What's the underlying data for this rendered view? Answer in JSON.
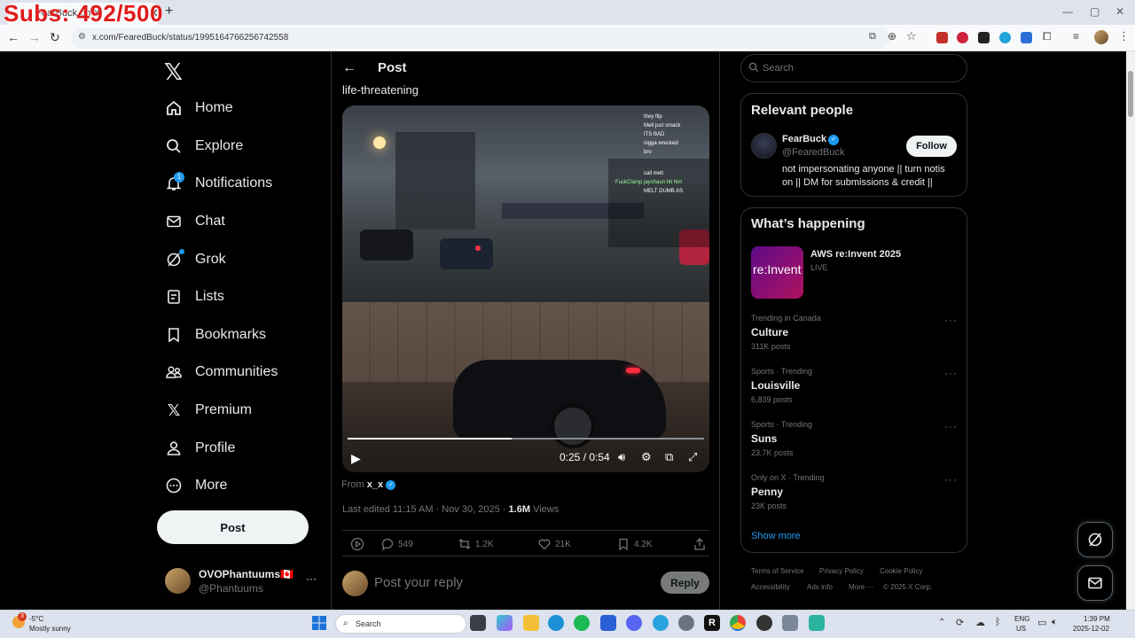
{
  "overlay": {
    "text": "Subs: 492/500"
  },
  "browser": {
    "tab_title": "FearBuck on X",
    "url": "x.com/FearedBuck/status/1995164766256742558"
  },
  "nav": {
    "items": [
      {
        "label": "Home",
        "icon": "home-icon"
      },
      {
        "label": "Explore",
        "icon": "search-icon"
      },
      {
        "label": "Notifications",
        "icon": "bell-icon"
      },
      {
        "label": "Chat",
        "icon": "mail-icon"
      },
      {
        "label": "Grok",
        "icon": "grok-icon"
      },
      {
        "label": "Lists",
        "icon": "list-icon"
      },
      {
        "label": "Bookmarks",
        "icon": "bookmark-icon"
      },
      {
        "label": "Communities",
        "icon": "communities-icon"
      },
      {
        "label": "Premium",
        "icon": "x-logo-icon"
      },
      {
        "label": "Profile",
        "icon": "person-icon"
      },
      {
        "label": "More",
        "icon": "more-circle-icon"
      }
    ],
    "notification_count": "1",
    "post_button": "Post",
    "account": {
      "name": "OVOPhantuums🇨🇦",
      "handle": "@Phantuums",
      "more": "···"
    }
  },
  "post": {
    "header_title": "Post",
    "text": "life-threatening",
    "video": {
      "time": "0:25 / 0:54",
      "progress": 0.46,
      "chat": [
        "they flip",
        "Melt just smack",
        "ITS BAD",
        "nigga wrecked",
        "bro",
        "call melt",
        "FuckClamp jayshaun hit him",
        "MELT DUMB AS"
      ]
    },
    "from_prefix": "From",
    "from_user": "x_x",
    "edited": "Last edited 11:15 AM · Nov 30, 2025 ·",
    "views_count": "1.6M",
    "views_label": "Views",
    "actions": {
      "replies": "549",
      "reposts": "1.2K",
      "likes": "21K",
      "bookmarks": "4.2K"
    },
    "reply_placeholder": "Post your reply",
    "reply_button": "Reply"
  },
  "sidebar": {
    "search_placeholder": "Search",
    "relevant": {
      "title": "Relevant people",
      "name": "FearBuck",
      "handle": "@FearedBuck",
      "bio": "not impersonating anyone || turn notis on || DM for submissions & credit ||",
      "follow": "Follow"
    },
    "happening": {
      "title": "What’s happening",
      "event": {
        "name": "AWS re:Invent 2025",
        "status": "LIVE",
        "thumb_text": "re:Invent"
      },
      "trends": [
        {
          "context": "Trending in Canada",
          "name": "Culture",
          "posts": "311K posts"
        },
        {
          "context": "Sports · Trending",
          "name": "Louisville",
          "posts": "6,839 posts"
        },
        {
          "context": "Sports · Trending",
          "name": "Suns",
          "posts": "23.7K posts"
        },
        {
          "context": "Only on X · Trending",
          "name": "Penny",
          "posts": "23K posts"
        }
      ],
      "show_more": "Show more"
    },
    "footer": {
      "links": [
        "Terms of Service",
        "Privacy Policy",
        "Cookie Policy",
        "Accessibility",
        "Ads info",
        "More ···"
      ],
      "copyright": "© 2025 X Corp."
    }
  },
  "taskbar": {
    "weather_temp": "-5°C",
    "weather_desc": "Mostly sunny",
    "weather_badge": "3",
    "search": "Search",
    "lang1": "ENG",
    "lang2": "US",
    "time": "1:39 PM",
    "date": "2025-12-02"
  }
}
